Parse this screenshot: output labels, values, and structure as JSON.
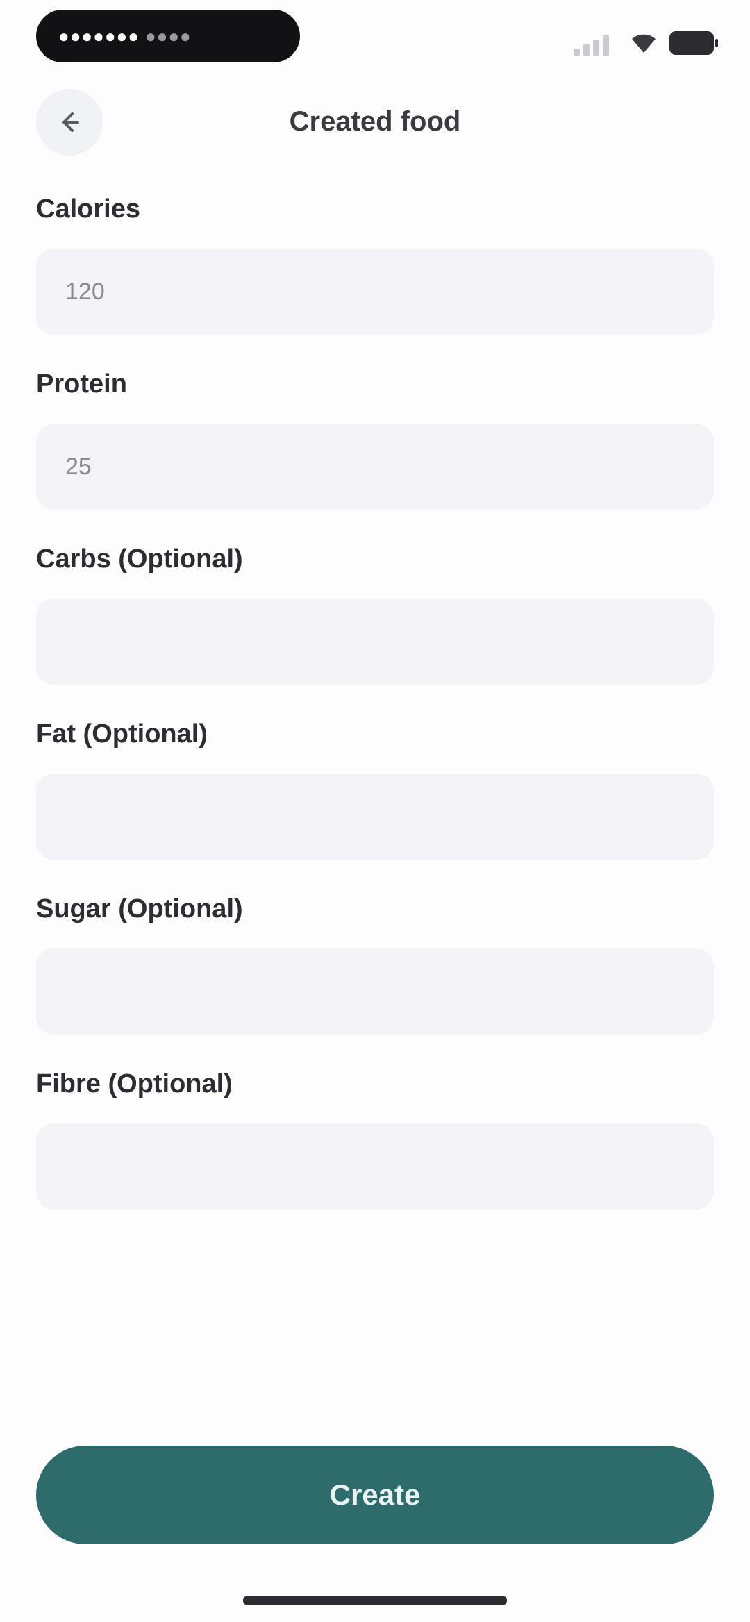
{
  "status_bar": {
    "pill_text": "●●●●●●●",
    "pill_text_dim": "●●●●",
    "icons": [
      "signal-icon",
      "wifi-icon",
      "battery-icon"
    ]
  },
  "header": {
    "title": "Created food",
    "back_icon": "arrow-left-icon"
  },
  "form": {
    "fields": [
      {
        "label": "Calories",
        "value": "120",
        "placeholder": ""
      },
      {
        "label": "Protein",
        "value": "25",
        "placeholder": ""
      },
      {
        "label": "Carbs (Optional)",
        "value": "",
        "placeholder": ""
      },
      {
        "label": "Fat (Optional)",
        "value": "",
        "placeholder": ""
      },
      {
        "label": "Sugar (Optional)",
        "value": "",
        "placeholder": ""
      },
      {
        "label": "Fibre (Optional)",
        "value": "",
        "placeholder": ""
      }
    ]
  },
  "actions": {
    "create_label": "Create"
  },
  "colors": {
    "accent": "#2e6c6b",
    "input_background": "#f3f3f8",
    "page_background": "#fdfdfe"
  }
}
